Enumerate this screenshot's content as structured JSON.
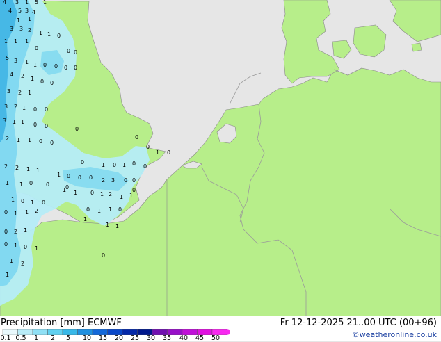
{
  "title": "Precipitation [mm]  ECMWF",
  "datetime": "Fr 12-12-2025 21..00 UTC (00+96)",
  "credit": "©weatheronline.co.uk",
  "colors": {
    "sea": "#e6e6e6",
    "land": "#b7ee8a",
    "border": "#9a9a9a",
    "precip_light": "#b5ecf7",
    "precip_mid": "#80d8f0",
    "precip_heavy": "#46b8e6"
  },
  "legend": {
    "swatches": [
      "#e8f8fc",
      "#b8ecf8",
      "#90e0f5",
      "#60d0f0",
      "#38b8e8",
      "#2090e0",
      "#1468d8",
      "#0a48c8",
      "#0428a8",
      "#00188c",
      "#7010b0",
      "#9810c8",
      "#c010d8",
      "#e010e0",
      "#f828f0"
    ],
    "ticks": [
      "0.1",
      "0.5",
      "1",
      "2",
      "5",
      "10",
      "15",
      "20",
      "25",
      "30",
      "35",
      "40",
      "45",
      "50"
    ]
  },
  "map_labels": [
    "4",
    "3",
    "1",
    "5",
    "1",
    "4",
    "5",
    "3",
    "4",
    "1",
    "1",
    "1",
    "1",
    "0",
    "3",
    "3",
    "2",
    "1",
    "1",
    "1",
    "0",
    "5",
    "3",
    "1",
    "1",
    "0",
    "0",
    "0",
    "0",
    "0",
    "0",
    "4",
    "2",
    "1",
    "0",
    "0",
    "3",
    "2",
    "1",
    "3",
    "2",
    "1",
    "0",
    "0",
    "3",
    "1",
    "1",
    "0",
    "0",
    "0",
    "2",
    "1",
    "1",
    "0",
    "0",
    "0",
    "1",
    "0",
    "0",
    "2",
    "2",
    "1",
    "1",
    "0",
    "1",
    "0",
    "1",
    "0",
    "0",
    "1",
    "1",
    "0",
    "0",
    "1",
    "0",
    "0",
    "0",
    "2",
    "3",
    "0",
    "0",
    "1",
    "0",
    "1",
    "0",
    "1",
    "1",
    "0",
    "1",
    "2",
    "1",
    "1",
    "0",
    "1",
    "1",
    "2",
    "0",
    "1",
    "1",
    "0",
    "1",
    "1",
    "0",
    "2",
    "1",
    "0",
    "1",
    "0",
    "1",
    "2",
    "1",
    "1",
    "1",
    "0",
    "0",
    "0",
    "1",
    "1",
    "0",
    "1"
  ]
}
